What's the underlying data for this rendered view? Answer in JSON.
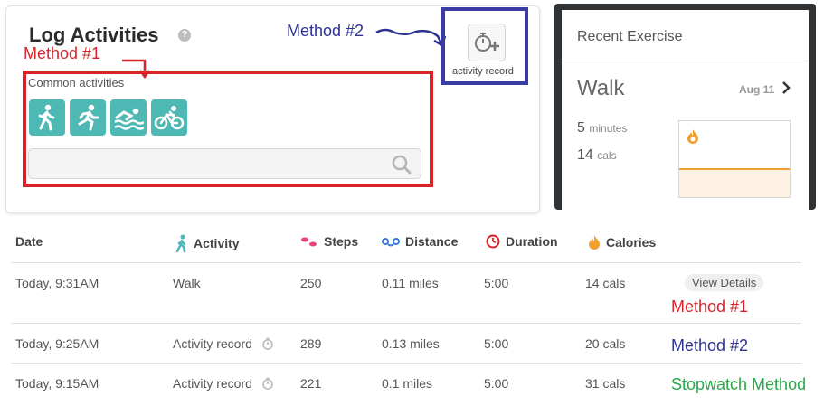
{
  "log": {
    "title": "Log Activities",
    "help": "?",
    "common_label": "Common activities",
    "activity_icons": [
      "walk-icon",
      "run-icon",
      "swim-icon",
      "bike-icon"
    ],
    "search_placeholder": "",
    "record_label": "activity record"
  },
  "annotations": {
    "method1": "Method #1",
    "method2": "Method #2",
    "stopwatch": "Stopwatch Method",
    "colors": {
      "method1": "#d8232a",
      "method2": "#2e3192",
      "stopwatch": "#2aa84a"
    }
  },
  "recent": {
    "title": "Recent Exercise",
    "activity": "Walk",
    "date": "Aug 11",
    "minutes_value": "5",
    "minutes_unit": "minutes",
    "cals_value": "14",
    "cals_unit": "cals"
  },
  "table": {
    "headers": {
      "date": "Date",
      "activity": "Activity",
      "steps": "Steps",
      "distance": "Distance",
      "duration": "Duration",
      "calories": "Calories"
    },
    "rows": [
      {
        "date": "Today, 9:31AM",
        "activity": "Walk",
        "steps": "250",
        "distance": "0.11 miles",
        "duration": "5:00",
        "calories": "14 cals",
        "action": "View Details",
        "annotation": "Method #1"
      },
      {
        "date": "Today, 9:25AM",
        "activity": "Activity record",
        "steps": "289",
        "distance": "0.13 miles",
        "duration": "5:00",
        "calories": "20 cals",
        "annotation": "Method #2"
      },
      {
        "date": "Today, 9:15AM",
        "activity": "Activity record",
        "steps": "221",
        "distance": "0.1 miles",
        "duration": "5:00",
        "calories": "31 cals",
        "annotation": "Stopwatch Method"
      }
    ]
  },
  "colors": {
    "accent_teal": "#4db8b4",
    "steps_pink": "#e8457c",
    "distance_blue": "#3a7bd5",
    "duration_red": "#d8232a",
    "calories_orange": "#f0a030"
  }
}
